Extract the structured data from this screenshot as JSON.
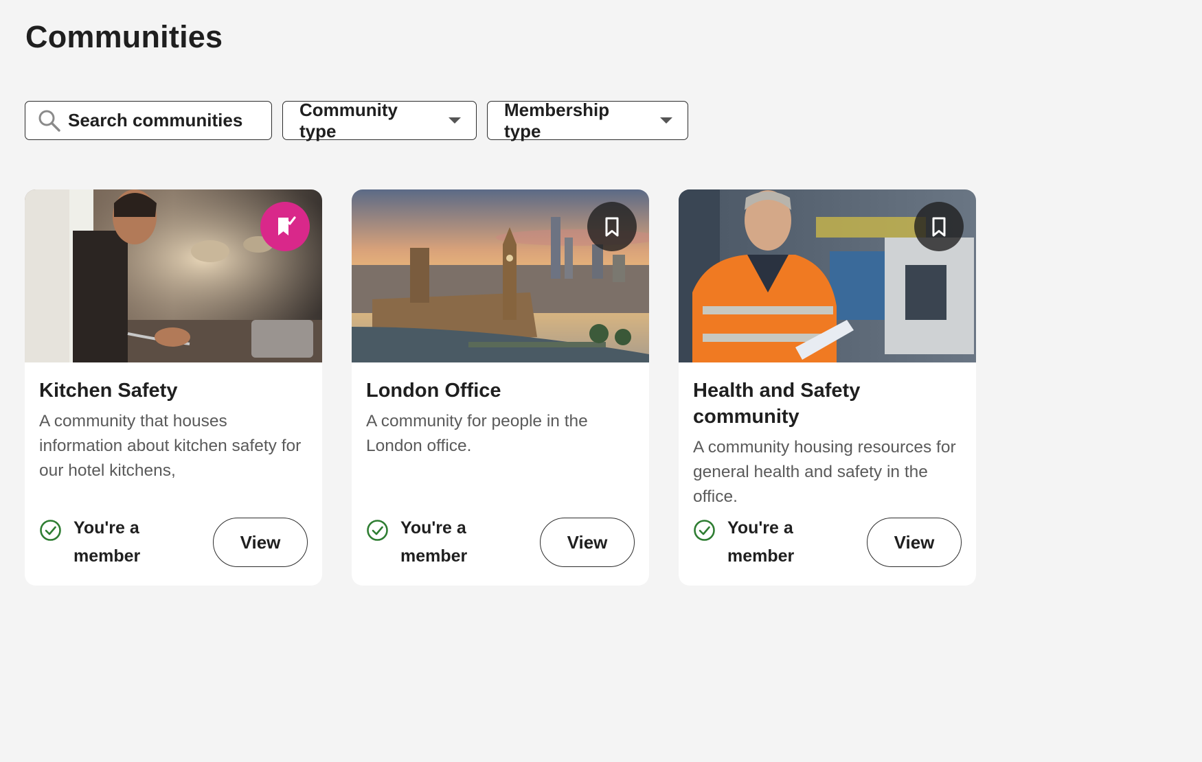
{
  "page": {
    "title": "Communities"
  },
  "filters": {
    "search_placeholder": "Search communities",
    "community_type_label": "Community type",
    "membership_type_label": "Membership type"
  },
  "colors": {
    "saved_bookmark": "#d9288a",
    "member_check": "#2e7d32",
    "background": "#f4f4f4"
  },
  "cards": [
    {
      "title": "Kitchen Safety",
      "description": "A community that houses information about kitchen safety for our hotel kitchens,",
      "membership_status": "You're a member",
      "action_label": "View",
      "bookmark_state": "saved",
      "bookmark_icon": "bookmark-check-icon"
    },
    {
      "title": "London Office",
      "description": "A community for people in the London office.",
      "membership_status": "You're a member",
      "action_label": "View",
      "bookmark_state": "unsaved",
      "bookmark_icon": "bookmark-icon"
    },
    {
      "title": "Health and Safety community",
      "description": "A community housing resources for general health and safety in the office.",
      "membership_status": "You're a member",
      "action_label": "View",
      "bookmark_state": "unsaved",
      "bookmark_icon": "bookmark-icon"
    }
  ]
}
